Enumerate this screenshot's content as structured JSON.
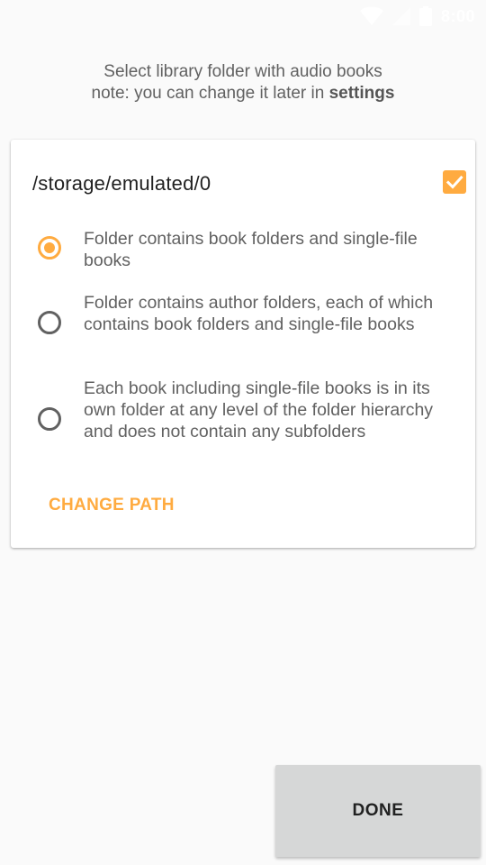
{
  "status_bar": {
    "time": "8:00",
    "icons": [
      "wifi-icon",
      "signal-icon",
      "battery-icon"
    ]
  },
  "header": {
    "line1": "Select library folder with audio books",
    "line2_prefix": "note: you can change it later in ",
    "line2_bold": "settings"
  },
  "card": {
    "path": "/storage/emulated/0",
    "path_checked": true,
    "options": [
      {
        "label": "Folder contains book folders and single-file books",
        "selected": true
      },
      {
        "label": "Folder contains author folders, each of which contains book folders and single-file books",
        "selected": false
      },
      {
        "label": "Each book including single-file books is in its own folder at any level of the folder hierarchy and does not contain any subfolders",
        "selected": false
      }
    ],
    "change_path_label": "CHANGE PATH"
  },
  "done_label": "DONE",
  "colors": {
    "accent": "#ffab40",
    "background": "#fafafa",
    "button": "#d6d7d7"
  }
}
